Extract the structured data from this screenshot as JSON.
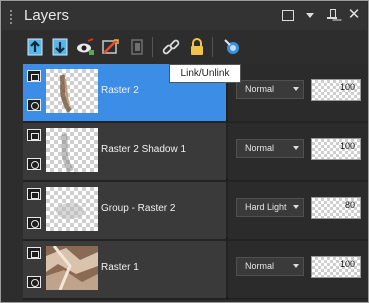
{
  "window": {
    "title": "Layers"
  },
  "toolbar": {
    "tooltip": "Link/Unlink",
    "buttons": [
      {
        "icon": "new-raster-layer-icon"
      },
      {
        "icon": "new-vector-layer-icon"
      },
      {
        "icon": "visibility-toggle-icon"
      },
      {
        "icon": "delete-layer-icon"
      },
      {
        "icon": "merge-layer-icon"
      },
      {
        "icon": "link-icon"
      },
      {
        "icon": "lock-icon"
      },
      {
        "icon": "properties-icon"
      }
    ]
  },
  "layers": [
    {
      "name": "Raster 2",
      "blend": "Normal",
      "opacity": "100",
      "selected": true
    },
    {
      "name": "Raster 2 Shadow 1",
      "blend": "Normal",
      "opacity": "100",
      "selected": false
    },
    {
      "name": "Group - Raster 2",
      "blend": "Hard Light",
      "opacity": "80",
      "selected": false
    },
    {
      "name": "Raster 1",
      "blend": "Normal",
      "opacity": "100",
      "selected": false
    }
  ],
  "colors": {
    "selection": "#3c8de6",
    "panel": "#2d2d2d",
    "row": "#3a3a3a"
  }
}
